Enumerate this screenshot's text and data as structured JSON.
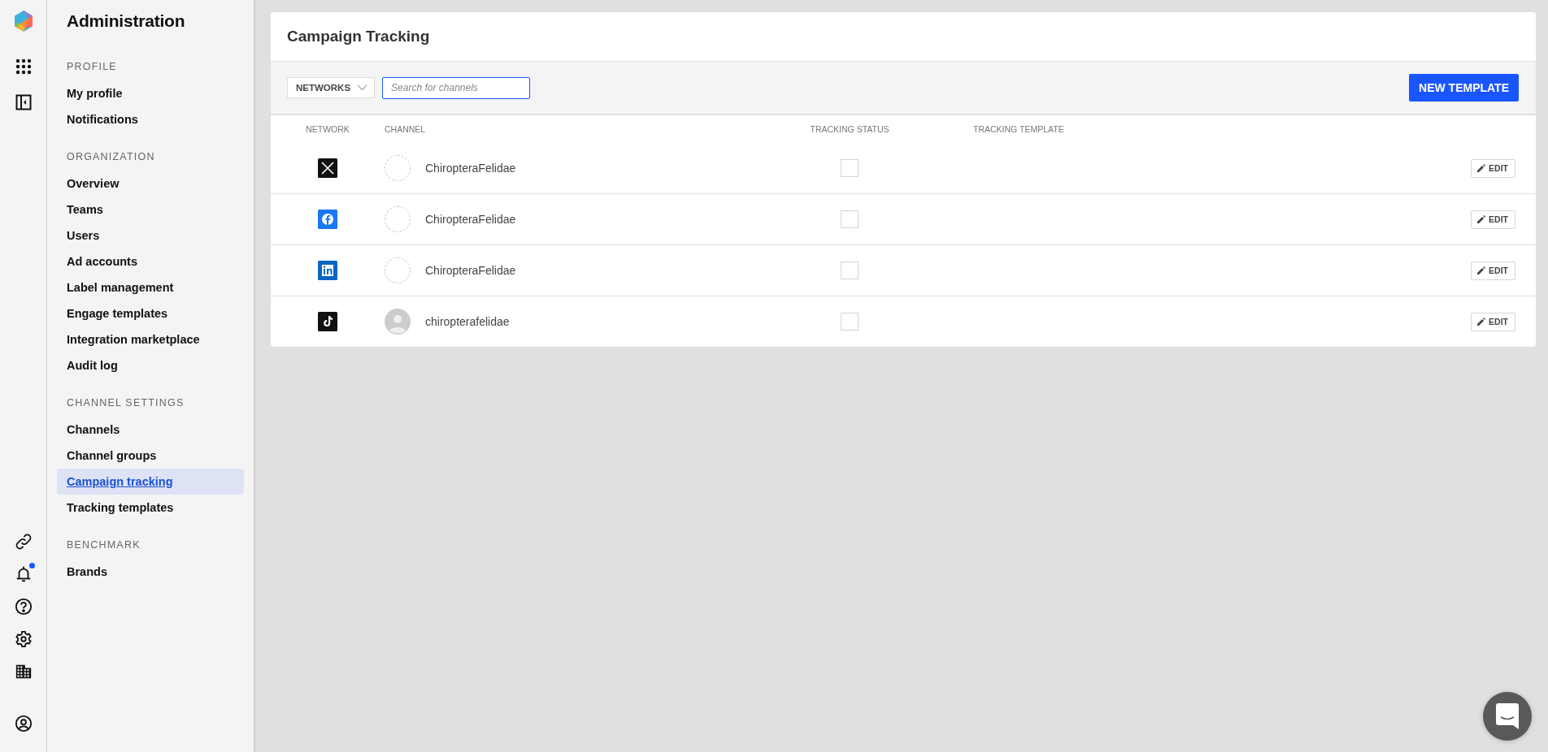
{
  "rail": {
    "top": [
      {
        "kind": "apps",
        "badge": false
      },
      {
        "kind": "collapse",
        "badge": false
      }
    ],
    "bottom": [
      {
        "kind": "link",
        "badge": false
      },
      {
        "kind": "bell",
        "badge": true
      },
      {
        "kind": "help",
        "badge": false
      },
      {
        "kind": "settings",
        "badge": false
      },
      {
        "kind": "building",
        "badge": false
      }
    ],
    "account": {
      "kind": "user",
      "badge": false
    }
  },
  "sidebar": {
    "title": "Administration",
    "sections": [
      {
        "heading": "PROFILE",
        "items": [
          {
            "label": "My profile",
            "selected": false
          },
          {
            "label": "Notifications",
            "selected": false
          }
        ]
      },
      {
        "heading": "ORGANIZATION",
        "items": [
          {
            "label": "Overview",
            "selected": false
          },
          {
            "label": "Teams",
            "selected": false
          },
          {
            "label": "Users",
            "selected": false
          },
          {
            "label": "Ad accounts",
            "selected": false
          },
          {
            "label": "Label management",
            "selected": false
          },
          {
            "label": "Engage templates",
            "selected": false
          },
          {
            "label": "Integration marketplace",
            "selected": false
          },
          {
            "label": "Audit log",
            "selected": false
          }
        ]
      },
      {
        "heading": "CHANNEL SETTINGS",
        "items": [
          {
            "label": "Channels",
            "selected": false
          },
          {
            "label": "Channel groups",
            "selected": false
          },
          {
            "label": "Campaign tracking",
            "selected": true
          },
          {
            "label": "Tracking templates",
            "selected": false
          }
        ]
      },
      {
        "heading": "BENCHMARK",
        "items": [
          {
            "label": "Brands",
            "selected": false
          }
        ]
      }
    ]
  },
  "page": {
    "title": "Campaign Tracking",
    "toolbar": {
      "filter": "NETWORKS",
      "search": {
        "placeholder": "Search for channels"
      },
      "new_button": "NEW TEMPLATE"
    },
    "table": {
      "columns": [
        "NETWORK",
        "CHANNEL",
        "TRACKING STATUS",
        "TRACKING TEMPLATE"
      ],
      "rows": [
        {
          "network": {
            "kind": "x"
          },
          "avatar": {
            "kind": "empty"
          },
          "channel": "ChiropteraFelidae",
          "tracking": false,
          "action": "EDIT"
        },
        {
          "network": {
            "kind": "facebook"
          },
          "avatar": {
            "kind": "empty"
          },
          "channel": "ChiropteraFelidae",
          "tracking": false,
          "action": "EDIT"
        },
        {
          "network": {
            "kind": "linkedin"
          },
          "avatar": {
            "kind": "empty"
          },
          "channel": "ChiropteraFelidae",
          "tracking": false,
          "action": "EDIT"
        },
        {
          "network": {
            "kind": "tiktok"
          },
          "avatar": {
            "kind": "silhouette"
          },
          "channel": "chiropterafelidae",
          "tracking": false,
          "action": "EDIT"
        }
      ]
    }
  }
}
